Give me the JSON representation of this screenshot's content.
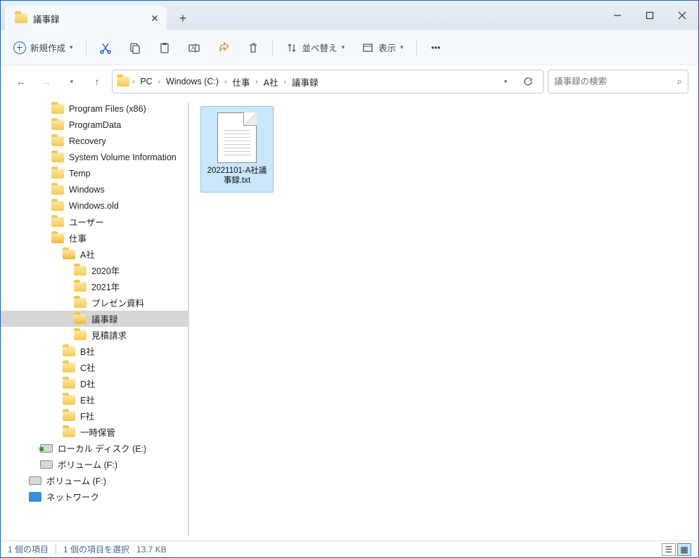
{
  "window": {
    "tab_title": "議事録"
  },
  "toolbar": {
    "new": "新規作成",
    "sort": "並べ替え",
    "view": "表示"
  },
  "breadcrumb": [
    "PC",
    "Windows (C:)",
    "仕事",
    "A社",
    "議事録"
  ],
  "search": {
    "placeholder": "議事録の検索"
  },
  "tree": [
    {
      "label": "Program Files (x86)",
      "depth": 1,
      "icon": "folder"
    },
    {
      "label": "ProgramData",
      "depth": 1,
      "icon": "folder"
    },
    {
      "label": "Recovery",
      "depth": 1,
      "icon": "folder"
    },
    {
      "label": "System Volume Information",
      "depth": 1,
      "icon": "folder"
    },
    {
      "label": "Temp",
      "depth": 1,
      "icon": "folder"
    },
    {
      "label": "Windows",
      "depth": 1,
      "icon": "folder"
    },
    {
      "label": "Windows.old",
      "depth": 1,
      "icon": "folder"
    },
    {
      "label": "ユーザー",
      "depth": 1,
      "icon": "folder"
    },
    {
      "label": "仕事",
      "depth": 1,
      "icon": "folder-open"
    },
    {
      "label": "A社",
      "depth": 2,
      "icon": "folder-open"
    },
    {
      "label": "2020年",
      "depth": 3,
      "icon": "folder"
    },
    {
      "label": "2021年",
      "depth": 3,
      "icon": "folder"
    },
    {
      "label": "プレゼン資料",
      "depth": 3,
      "icon": "folder"
    },
    {
      "label": "議事録",
      "depth": 3,
      "icon": "folder-open",
      "selected": true
    },
    {
      "label": "見積請求",
      "depth": 3,
      "icon": "folder"
    },
    {
      "label": "B社",
      "depth": 2,
      "icon": "folder"
    },
    {
      "label": "C社",
      "depth": 2,
      "icon": "folder"
    },
    {
      "label": "D社",
      "depth": 2,
      "icon": "folder"
    },
    {
      "label": "E社",
      "depth": 2,
      "icon": "folder"
    },
    {
      "label": "F社",
      "depth": 2,
      "icon": "folder"
    },
    {
      "label": "一時保管",
      "depth": 2,
      "icon": "folder"
    },
    {
      "label": "ローカル ディスク (E:)",
      "depth": 0,
      "icon": "drive-green"
    },
    {
      "label": "ボリューム (F:)",
      "depth": 0,
      "icon": "drive"
    },
    {
      "label": "ボリューム (F:)",
      "depth": -1,
      "icon": "drive"
    },
    {
      "label": "ネットワーク",
      "depth": -1,
      "icon": "network"
    }
  ],
  "files": [
    {
      "name": "20221101-A社議事録.txt",
      "selected": true
    }
  ],
  "status": {
    "count": "1 個の項目",
    "selected": "1 個の項目を選択",
    "size": "13.7 KB"
  }
}
